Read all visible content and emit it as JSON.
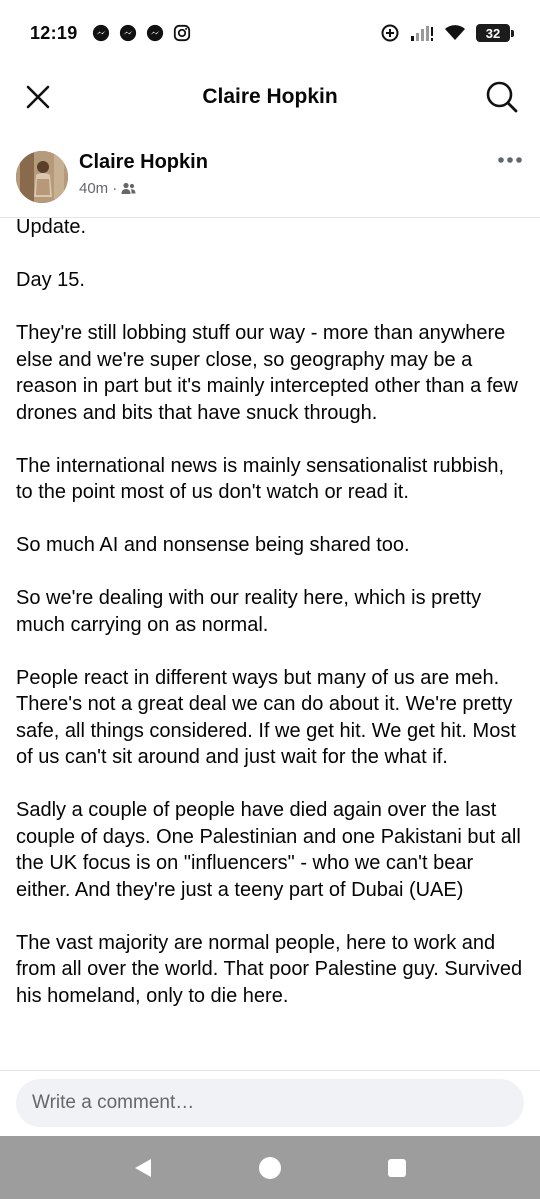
{
  "status_bar": {
    "time": "12:19",
    "notification_icons": [
      "messenger-icon",
      "messenger-icon",
      "messenger-icon",
      "instagram-icon"
    ],
    "battery": "32"
  },
  "header": {
    "title": "Claire Hopkin",
    "close_icon": "close-icon",
    "search_icon": "search-icon"
  },
  "post": {
    "author": "Claire Hopkin",
    "time": "40m",
    "separator": "·",
    "audience_icon": "friends-icon",
    "paragraphs": [
      "Update.",
      "Day 15.",
      "They're still lobbing stuff our way - more than anywhere else and we're super close, so geography may be a reason in part but it's mainly intercepted other than a few drones and bits that have snuck through.",
      "The international news is mainly sensationalist rubbish, to the point most of us don't watch or read it.",
      "So much AI and nonsense being shared too.",
      "So we're dealing with our reality here, which is pretty much carrying on as normal.",
      "People react in different ways but many of us are meh. There's not a great deal we can do about it. We're pretty safe, all things considered. If we get hit. We get hit. Most of us can't sit around and just wait for the what if.",
      "Sadly a couple of people have died again over the last couple of days. One Palestinian and one Pakistani but all the UK focus is on \"influencers\" - who we can't bear either. And they're just a teeny part of Dubai (UAE)",
      "The vast majority are normal people, here to work and from all over the world. That poor Palestine guy. Survived his homeland, only to die here."
    ]
  },
  "comment": {
    "placeholder": "Write a comment…"
  },
  "colors": {
    "nav_bar": "#9d9d9d",
    "meta_text": "#65676b",
    "input_bg": "#f0f2f5"
  }
}
